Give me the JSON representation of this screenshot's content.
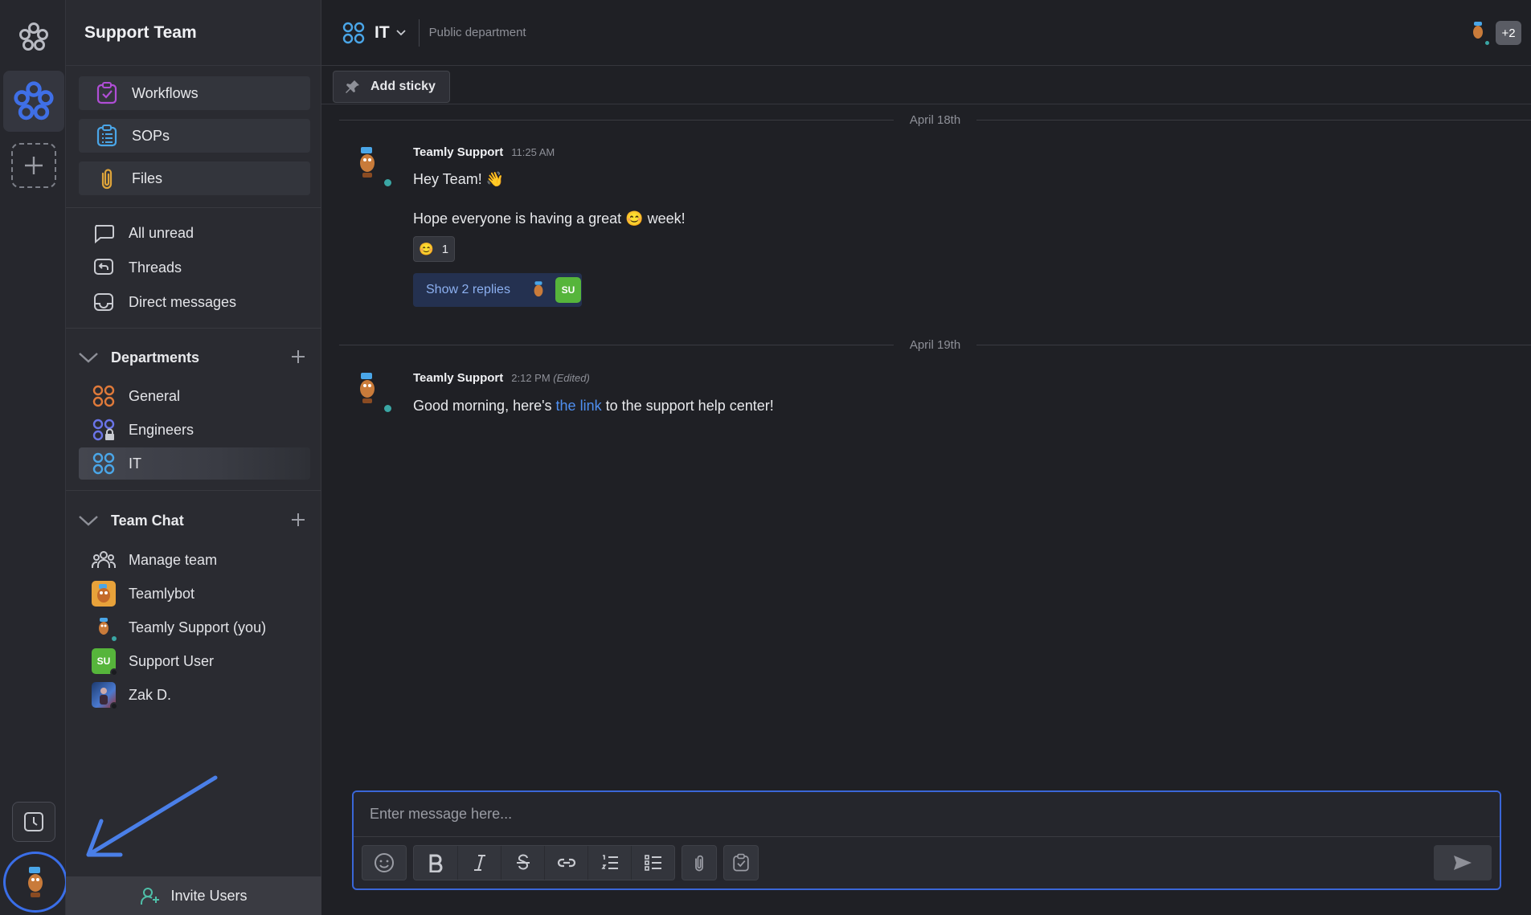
{
  "workspace": {
    "name": "Support Team"
  },
  "sidebar": {
    "pills": [
      {
        "label": "Workflows",
        "icon": "workflow-check-icon",
        "color": "#b04ed6"
      },
      {
        "label": "SOPs",
        "icon": "list-clipboard-icon",
        "color": "#4aa6e8"
      },
      {
        "label": "Files",
        "icon": "paperclip-icon",
        "color": "#e0a53a"
      }
    ],
    "nav": [
      {
        "label": "All unread",
        "icon": "chat-bubble-icon"
      },
      {
        "label": "Threads",
        "icon": "threads-icon"
      },
      {
        "label": "Direct messages",
        "icon": "inbox-icon"
      }
    ],
    "departments": {
      "title": "Departments",
      "items": [
        {
          "label": "General",
          "color": "#e07a3a"
        },
        {
          "label": "Engineers",
          "color": "#6a74e8"
        },
        {
          "label": "IT",
          "color": "#4aa6e8",
          "active": true
        }
      ]
    },
    "team_chat": {
      "title": "Team Chat",
      "items": [
        {
          "label": "Manage team",
          "icon": "team-icon"
        },
        {
          "label": "Teamlybot",
          "icon": "bot-avatar"
        },
        {
          "label": "Teamly Support (you)",
          "icon": "user-avatar",
          "status": "#3aa6a4"
        },
        {
          "label": "Support User",
          "initials": "SU",
          "status": "#2a2b31"
        },
        {
          "label": "Zak D.",
          "icon": "photo-avatar",
          "status": "#2a2b31"
        }
      ]
    },
    "invite_label": "Invite Users"
  },
  "channel": {
    "name": "IT",
    "description": "Public department",
    "member_extra": "+2"
  },
  "toolbar": {
    "add_sticky": "Add sticky"
  },
  "messages": [
    {
      "date": "April 18th",
      "author": "Teamly Support",
      "time": "11:25 AM",
      "line1": "Hey Team! 👋",
      "line2_pre": "Hope everyone is having a great",
      "line2_post": "week!",
      "reaction_count": "1",
      "replies_label": "Show 2 replies",
      "reply_badge": "SU"
    },
    {
      "date": "April 19th",
      "author": "Teamly Support",
      "time": "2:12 PM",
      "edited": "(Edited)",
      "text_pre": "Good morning, here's",
      "link_text": "the link",
      "text_post": "to the support help center!"
    }
  ],
  "composer": {
    "placeholder": "Enter message here..."
  },
  "colors": {
    "accent": "#3a66d8",
    "online": "#3aa6a4",
    "su_badge": "#56b53b"
  }
}
